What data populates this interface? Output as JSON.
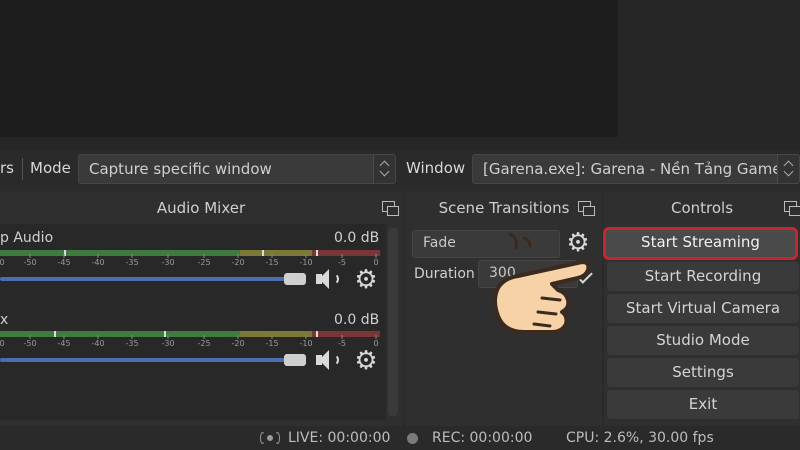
{
  "props_bar": {
    "source_label_fragment": "rs",
    "mode_label": "Mode",
    "mode_value": "Capture specific window",
    "window_label": "Window",
    "window_value": "[Garena.exe]: Garena - Nền Tảng Game"
  },
  "audio_mixer": {
    "title": "Audio Mixer",
    "tracks": [
      {
        "name": "p Audio",
        "db": "0.0 dB",
        "volume_fraction": 0.78
      },
      {
        "name": "x",
        "db": "0.0 dB",
        "volume_fraction": 0.78
      }
    ],
    "scale_labels": [
      "-60",
      "-50",
      "-45",
      "-40",
      "-35",
      "-30",
      "-25",
      "-20",
      "-15",
      "-10",
      "-5",
      "0"
    ]
  },
  "scene_transitions": {
    "title": "Scene Transitions",
    "transition": "Fade",
    "duration_label": "Duration",
    "duration_value": "300"
  },
  "controls": {
    "title": "Controls",
    "buttons": [
      "Start Streaming",
      "Start Recording",
      "Start Virtual Camera",
      "Studio Mode",
      "Settings",
      "Exit"
    ],
    "highlighted": "Start Streaming"
  },
  "status": {
    "live": "LIVE: 00:00:00",
    "rec": "REC: 00:00:00",
    "cpu": "CPU: 2.6%, 30.00 fps"
  },
  "icons": {
    "gear": "gear-icon",
    "speaker": "speaker-icon",
    "float": "float-icon",
    "hand": "pointing-hand-icon",
    "live": "broadcast-icon"
  },
  "colors": {
    "highlight_border": "#c8262e",
    "meter_green": "#3f7a3f",
    "meter_yellow": "#7a7a36",
    "meter_red": "#7a3636",
    "slider_blue": "#4a6fb0"
  }
}
